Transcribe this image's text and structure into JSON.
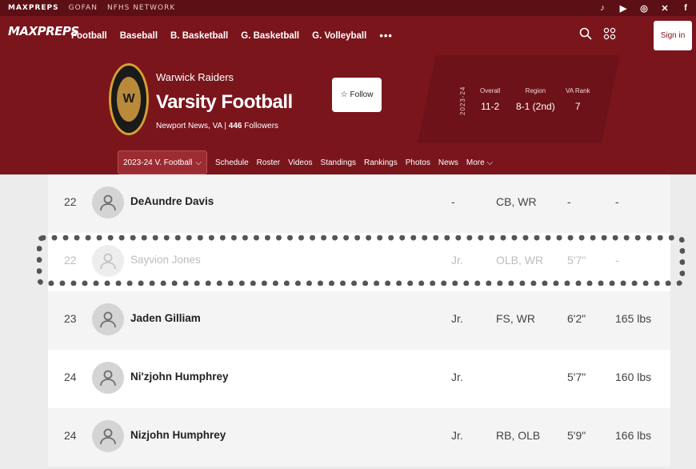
{
  "topbar": {
    "brands": [
      "MAXPREPS",
      "GOFAN",
      "NFHS NETWORK"
    ]
  },
  "social": [
    "tiktok-icon",
    "youtube-icon",
    "instagram-icon",
    "x-icon",
    "facebook-icon"
  ],
  "nav": {
    "logo": "MAXPREPS",
    "links": [
      "Football",
      "Baseball",
      "B. Basketball",
      "G. Basketball",
      "G. Volleyball"
    ],
    "more": "•••",
    "signin": "Sign in"
  },
  "team": {
    "school": "Warwick Raiders",
    "name": "Varsity Football",
    "location": "Newport News, VA",
    "followers_count": "446",
    "followers_label": "Followers",
    "follow_label": "Follow",
    "season": "2023-24",
    "stats": [
      {
        "label": "Overall",
        "value": "11-2"
      },
      {
        "label": "Region",
        "value": "8-1 (2nd)"
      },
      {
        "label": "VA Rank",
        "value": "7"
      }
    ]
  },
  "subnav": {
    "active": "2023-24 V. Football",
    "links": [
      "Schedule",
      "Roster",
      "Videos",
      "Standings",
      "Rankings",
      "Photos",
      "News",
      "More"
    ]
  },
  "roster": [
    {
      "num": "22",
      "name": "DeAundre Davis",
      "grade": "-",
      "pos": "CB, WR",
      "height": "-",
      "weight": "-"
    },
    {
      "num": "22",
      "name": "Sayvion Jones",
      "grade": "Jr.",
      "pos": "OLB, WR",
      "height": "5'7\"",
      "weight": "-"
    },
    {
      "num": "23",
      "name": "Jaden Gilliam",
      "grade": "Jr.",
      "pos": "FS, WR",
      "height": "6'2\"",
      "weight": "165 lbs"
    },
    {
      "num": "24",
      "name": "Ni'zjohn Humphrey",
      "grade": "Jr.",
      "pos": "",
      "height": "5'7\"",
      "weight": "160 lbs"
    },
    {
      "num": "24",
      "name": "Nizjohn Humphrey",
      "grade": "Jr.",
      "pos": "RB, OLB",
      "height": "5'9\"",
      "weight": "166 lbs"
    }
  ]
}
